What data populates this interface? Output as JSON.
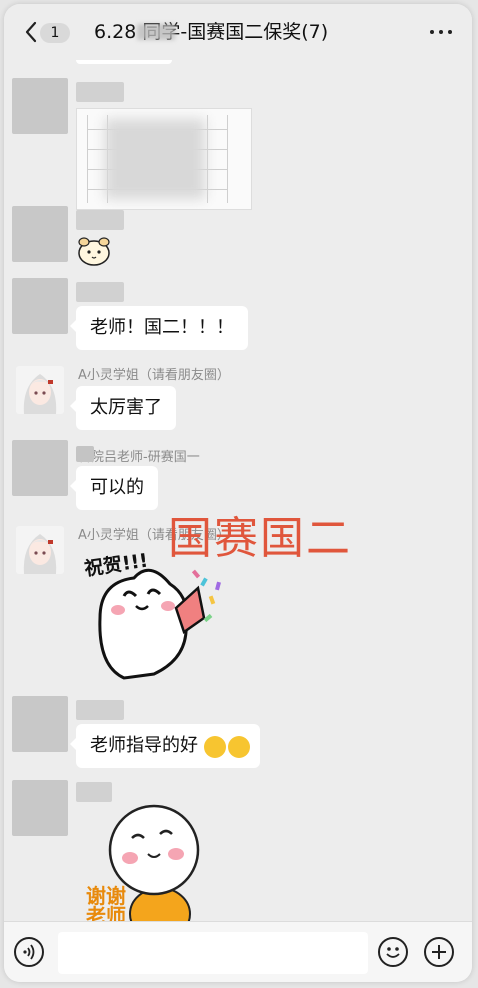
{
  "header": {
    "badge": "1",
    "title": "6.28  同学-国赛国二保奖(7)"
  },
  "messages": {
    "m3_text": "老师！国二！！！",
    "m4_name": "A小灵学姐（请看朋友圈）",
    "m4_text": "太厉害了",
    "m5_name": "科院吕老师-研赛国一",
    "m5_text": "可以的",
    "m6_name": "A小灵学姐（请看朋友圈）",
    "m6_sticker_text": "祝贺!!!",
    "m7_text": "老师指导的好",
    "m8_sticker_text": "谢谢老师"
  },
  "overlay": {
    "text": "国赛国二",
    "color": "#e0563c"
  },
  "icons": {
    "back": "chevron-left-icon",
    "more": "more-dots-icon",
    "voice": "voice-icon",
    "emoji": "emoji-icon",
    "plus": "plus-icon"
  }
}
